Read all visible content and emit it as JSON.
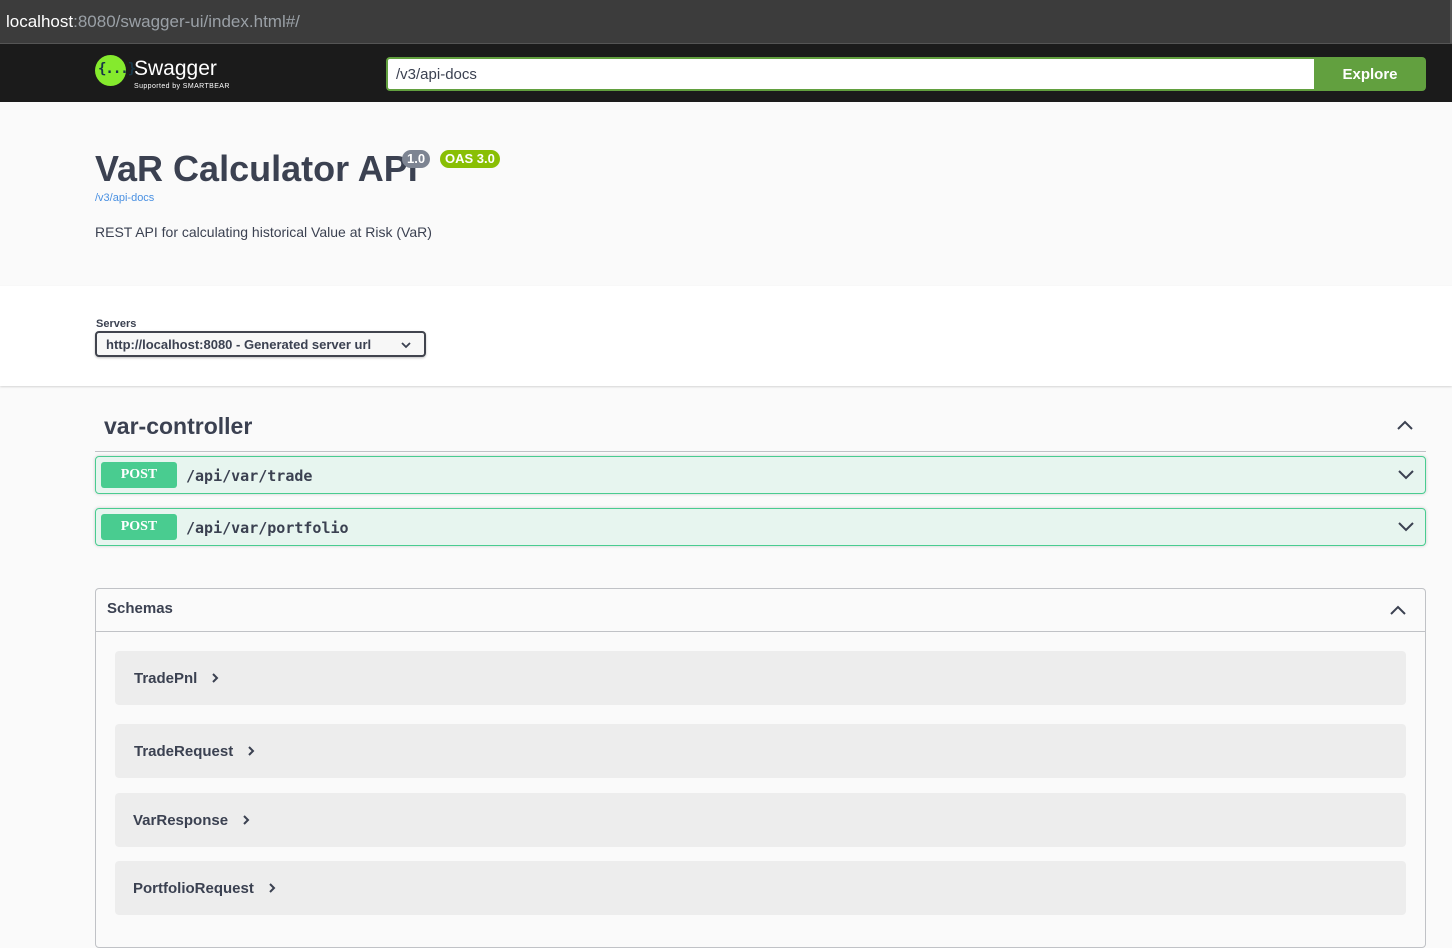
{
  "browser": {
    "url_host": "localhost",
    "url_rest": ":8080/swagger-ui/index.html#/"
  },
  "topbar": {
    "logo_text": "Swagger",
    "logo_subtext": "Supported by SMARTBEAR",
    "logo_glyph": "{...}",
    "search_value": "/v3/api-docs",
    "explore_label": "Explore"
  },
  "info": {
    "title": "VaR Calculator API",
    "version_badge": "1.0",
    "oas_badge": "OAS 3.0",
    "spec_link": "/v3/api-docs",
    "description": "REST API for calculating historical Value at Risk (VaR)"
  },
  "servers": {
    "label": "Servers",
    "selected": "http://localhost:8080 - Generated server url"
  },
  "tag": {
    "name": "var-controller",
    "operations": [
      {
        "method": "POST",
        "path": "/api/var/trade"
      },
      {
        "method": "POST",
        "path": "/api/var/portfolio"
      }
    ]
  },
  "schemas": {
    "title": "Schemas",
    "models": [
      "TradePnl",
      "TradeRequest",
      "VarResponse",
      "PortfolioRequest"
    ]
  },
  "colors": {
    "topbar_bg": "#1b1b1b",
    "explore_green": "#62a03f",
    "post_green": "#49cc90",
    "logo_green": "#85ea2d",
    "oas_badge": "#89bf04",
    "version_badge": "#7d8492",
    "link_blue": "#4990e2"
  }
}
